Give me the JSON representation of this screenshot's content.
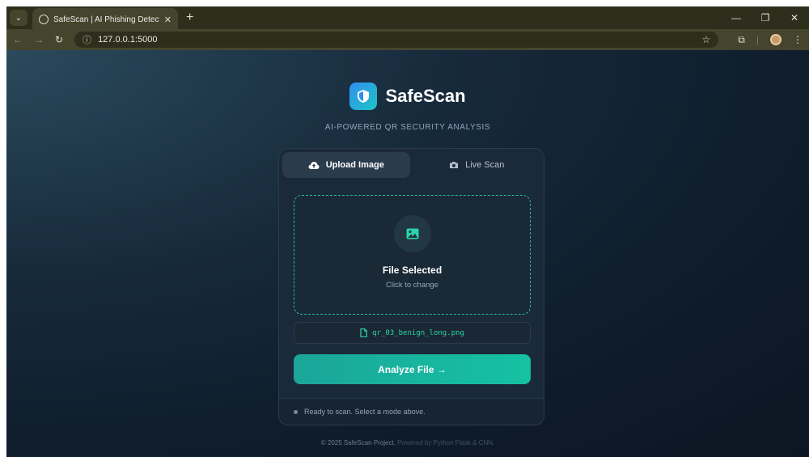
{
  "browser": {
    "tab_title": "SafeScan | AI Phishing Detector",
    "url": "127.0.0.1:5000",
    "new_tab_symbol": "+",
    "tab_close_symbol": "✕",
    "minimize_symbol": "—",
    "restore_symbol": "❐",
    "close_symbol": "✕"
  },
  "brand": {
    "name": "SafeScan",
    "tagline": "AI-POWERED QR SECURITY ANALYSIS"
  },
  "tabs": [
    {
      "label": "Upload Image",
      "icon": "cloud-upload-icon",
      "active": true
    },
    {
      "label": "Live Scan",
      "icon": "camera-icon",
      "active": false
    }
  ],
  "dropzone": {
    "title": "File Selected",
    "subtitle": "Click to change",
    "icon": "image-icon"
  },
  "file": {
    "name": "qr_03_benign_long.png"
  },
  "analyze": {
    "label": "Analyze File →"
  },
  "status": {
    "text": "Ready to scan. Select a mode above."
  },
  "footer": {
    "prefix": "© 2025 SafeScan Project.",
    "suffix": "Powered by Python Flask & CNN."
  },
  "colors": {
    "accent": "#1fbf9f",
    "background": "#0f1d2c",
    "card": "#1b2a3a"
  }
}
